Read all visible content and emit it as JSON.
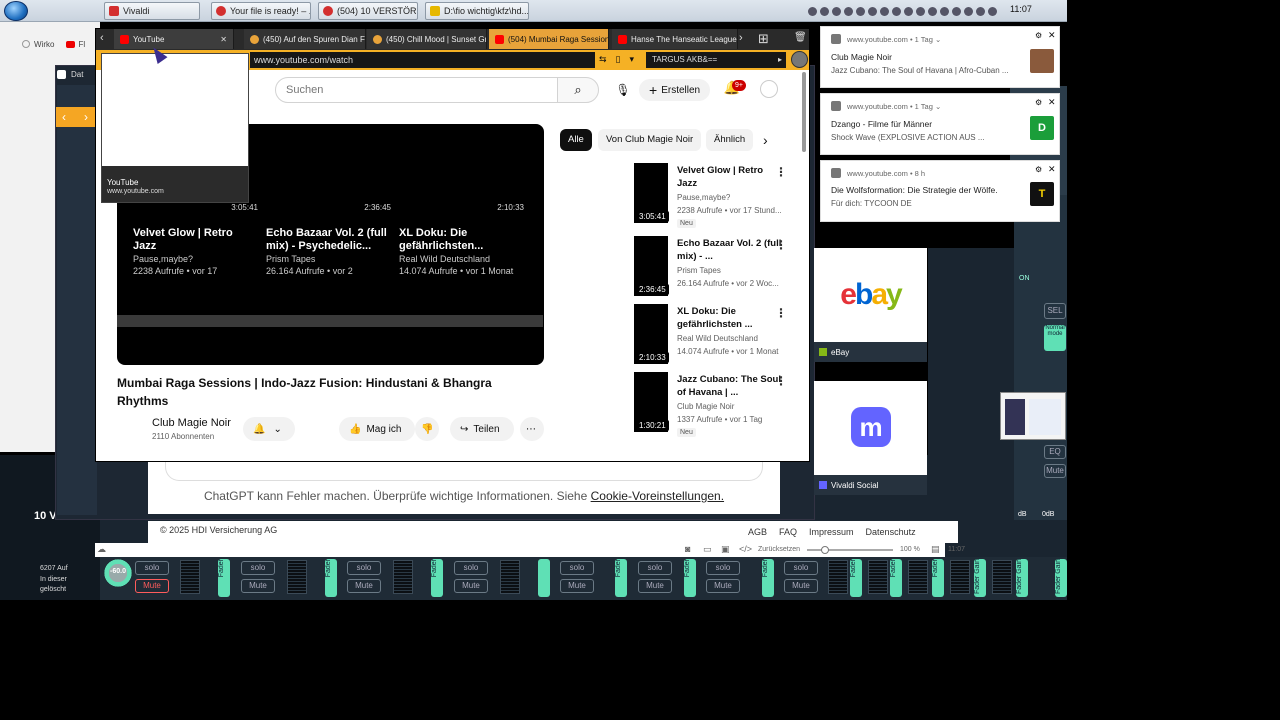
{
  "taskbar": {
    "buttons": [
      {
        "label": "Vivaldi",
        "color": "#d32f2f"
      },
      {
        "label": "Your file is ready! – ...",
        "color": "#d32f2f"
      },
      {
        "label": "(504) 10 VERSTÖREN...",
        "color": "#d32f2f"
      },
      {
        "label": "D:\\fio wichtig\\kfz\\hd...",
        "color": "#e6b800"
      }
    ],
    "clock": "11:07"
  },
  "background": {
    "tab1": "Wirko",
    "tab2": "Fl",
    "vivaldi_title": "Dat",
    "side_counter": "10 V",
    "side_text_1": "6207 Auf",
    "side_text_2": "In dieser",
    "side_text_3": "gelöscht"
  },
  "browser": {
    "tabs": [
      {
        "label": "YouTube",
        "color": "#ff0000",
        "state": "active"
      },
      {
        "label": "(450) Auf den Spuren Dian F",
        "color": "#e8a33a",
        "state": "normal"
      },
      {
        "label": "(450) Chill Mood | Sunset Gr",
        "color": "#e8a33a",
        "state": "normal"
      },
      {
        "label": "(504) Mumbai Raga Session",
        "color": "#ff0000",
        "state": "orange"
      },
      {
        "label": "Hanse The Hanseatic League",
        "color": "#ff0000",
        "state": "normal"
      }
    ],
    "url": "www.youtube.com/watch",
    "bookmark_label": "TARGUS  AKB&==",
    "accent": "#f5b125"
  },
  "tab_tooltip": {
    "title": "YouTube",
    "url": "www.youtube.com"
  },
  "youtube": {
    "search_placeholder": "Suchen",
    "create_label": "Erstellen",
    "notif_badge": "9+",
    "endcards": [
      {
        "title": "Velvet Glow | Retro Jazz",
        "channel": "Pause,maybe?",
        "meta": "2238 Aufrufe • vor 17",
        "duration": "3:05:41"
      },
      {
        "title": "Echo Bazaar Vol. 2 (full mix) - Psychedelic...",
        "channel": "Prism Tapes",
        "meta": "26.164 Aufrufe • vor 2",
        "duration": "2:36:45"
      },
      {
        "title": "XL Doku: Die gefährlichsten...",
        "channel": "Real Wild Deutschland",
        "meta": "14.074 Aufrufe • vor 1 Monat",
        "duration": "2:10:33"
      }
    ],
    "video_title": "Mumbai Raga Sessions | Indo-Jazz Fusion: Hindustani & Bhangra Rhythms",
    "channel_name": "Club Magie Noir",
    "subscribers": "2110 Abonnenten",
    "like_label": "Mag ich",
    "share_label": "Teilen",
    "chips": [
      "Alle",
      "Von Club Magie Noir",
      "Ähnlich"
    ],
    "related": [
      {
        "title": "Velvet Glow | Retro Jazz",
        "channel": "Pause,maybe?",
        "meta": "2238 Aufrufe • vor 17 Stund...",
        "duration": "3:05:41",
        "badge": "Neu"
      },
      {
        "title": "Echo Bazaar Vol. 2 (full mix) - ...",
        "channel": "Prism Tapes",
        "meta": "26.164 Aufrufe • vor 2 Woc...",
        "duration": "2:36:45",
        "badge": ""
      },
      {
        "title": "XL Doku: Die gefährlichsten ...",
        "channel": "Real Wild Deutschland",
        "meta": "14.074 Aufrufe • vor 1 Monat",
        "duration": "2:10:33",
        "badge": ""
      },
      {
        "title": "Jazz Cubano: The Soul of Havana | ...",
        "channel": "Club Magie Noir",
        "meta": "1337 Aufrufe • vor 1 Tag",
        "duration": "1:30:21",
        "badge": "Neu"
      }
    ]
  },
  "notifications": [
    {
      "source": "www.youtube.com • 1 Tag ⌄",
      "title": "Club Magie Noir",
      "body": "Jazz Cubano: The Soul of Havana | Afro-Cuban ...",
      "thumb_color": "#8a5a3c",
      "thumb_text": ""
    },
    {
      "source": "www.youtube.com • 1 Tag ⌄",
      "title": "Dzango - Filme für Männer",
      "body": "Shock Wave (EXPLOSIVE ACTION AUS ...",
      "thumb_color": "#1b9e3a",
      "thumb_text": "D"
    },
    {
      "source": "www.youtube.com • 8 h",
      "title": "Die Wolfsformation: Die Strategie der Wölfe.",
      "body": "Für dich: TYCOON DE",
      "thumb_color": "#111111",
      "thumb_text": "T"
    }
  ],
  "speed_dial": [
    {
      "label": "eBay"
    },
    {
      "label": "Vivaldi Social"
    }
  ],
  "chatgpt": {
    "note": "ChatGPT kann Fehler machen. Überprüfe wichtige Informationen. Siehe",
    "note_link": "Cookie-Voreinstellungen."
  },
  "hdi": {
    "copyright": "© 2025 HDI Versicherung AG",
    "links": [
      "AGB",
      "FAQ",
      "Impressum",
      "Datenschutz"
    ]
  },
  "statusbar": {
    "reset": "Zurücksetzen",
    "zoom": "100 %",
    "time": "11:07"
  },
  "mixer": {
    "knob_value": "-60.0",
    "solo": "solo",
    "mute": "Mute",
    "fader": "Fader",
    "fader_gain": "Fader Gain",
    "side_labels": {
      "sel": "SEL",
      "eq": "EQ",
      "mute": "Mute",
      "normal_mode": "Normal mode",
      "on": "ON",
      "db": "dB",
      "odb": "0dB"
    }
  }
}
